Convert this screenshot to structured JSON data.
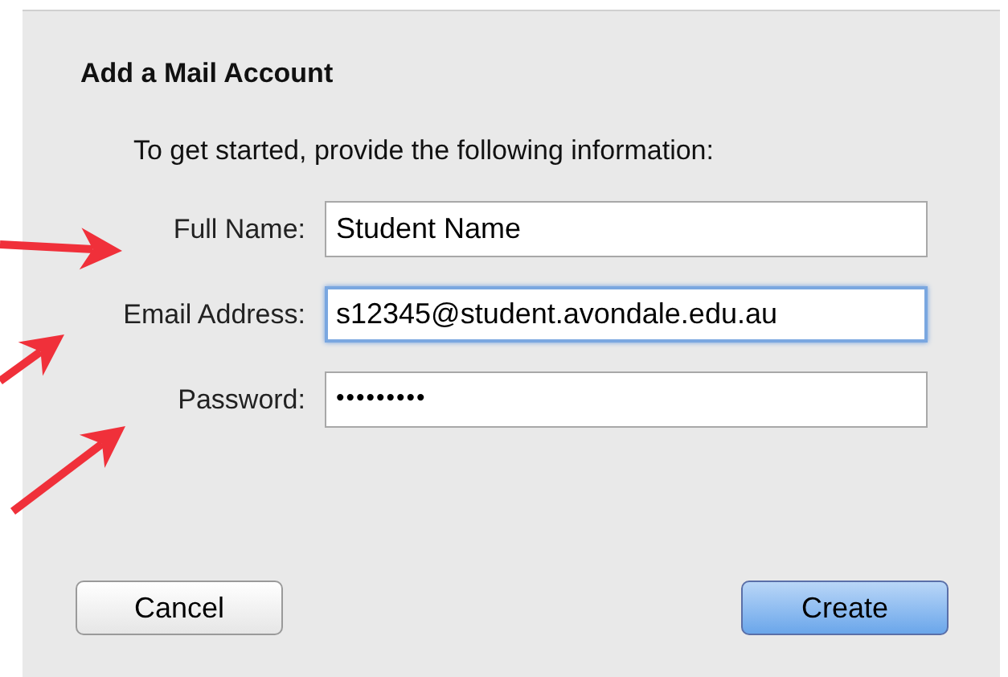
{
  "dialog": {
    "title": "Add a Mail Account",
    "intro": "To get started, provide the following information:"
  },
  "fields": [
    {
      "label": "Full Name:",
      "value": "Student Name",
      "kind": "text",
      "focused": false
    },
    {
      "label": "Email Address:",
      "value": "s12345@student.avondale.edu.au",
      "kind": "text",
      "focused": true
    },
    {
      "label": "Password:",
      "value": "•••••••••",
      "kind": "password",
      "focused": false
    }
  ],
  "buttons": [
    {
      "label": "Cancel",
      "default": false
    },
    {
      "label": "Create",
      "default": true
    }
  ]
}
